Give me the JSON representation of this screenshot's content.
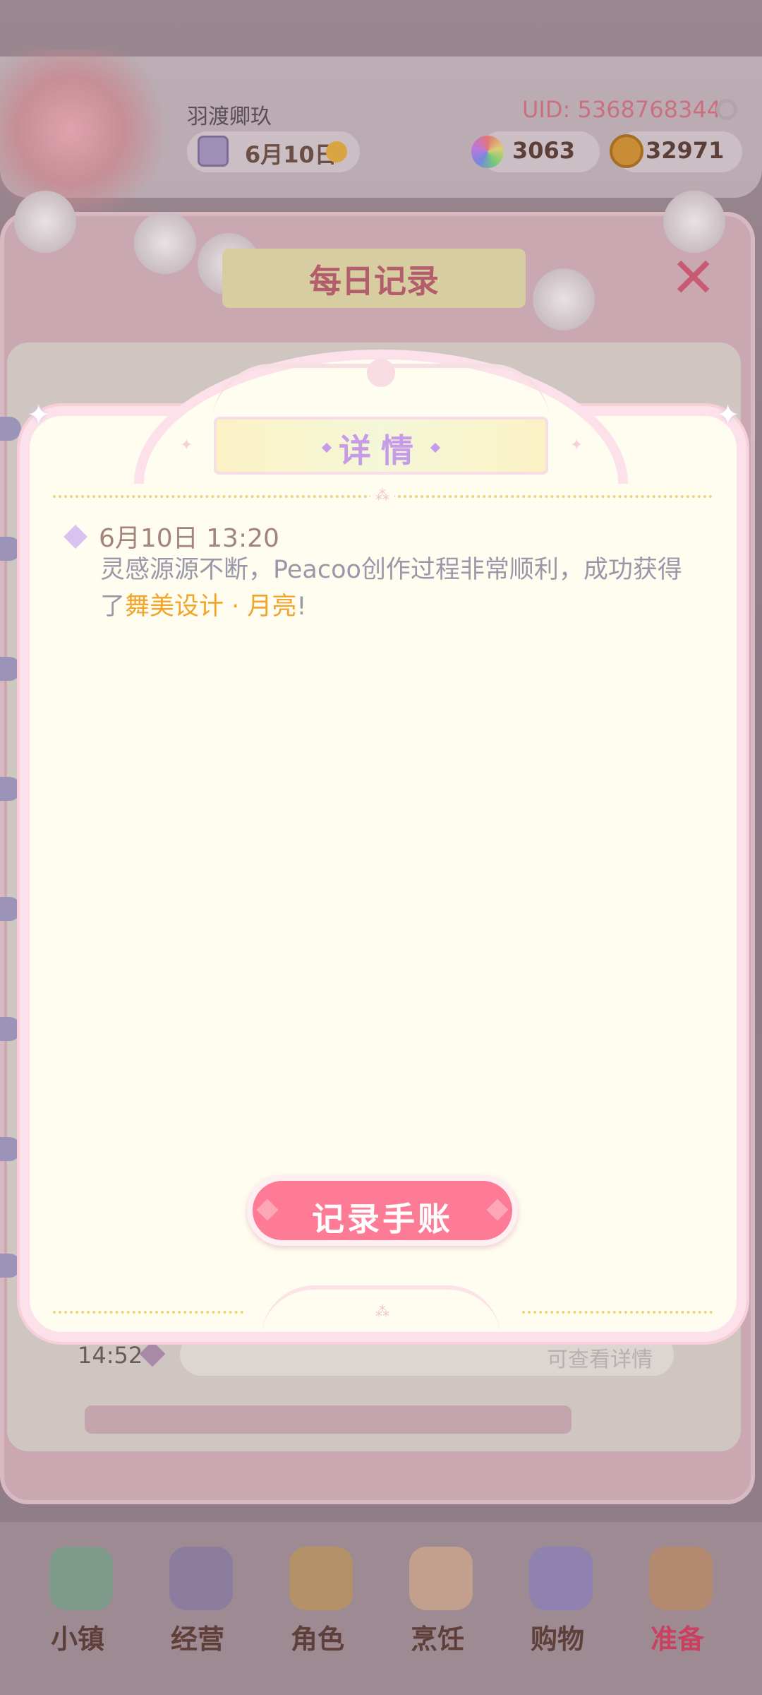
{
  "header": {
    "player_name": "羽渡卿玖",
    "uid": "UID: 5368768344",
    "date": "6月10日",
    "gems": "3063",
    "coins": "32971"
  },
  "record_panel": {
    "title": "每日记录",
    "close_icon": "✕",
    "row_time": "14:52",
    "row_hint": "可查看详情"
  },
  "modal": {
    "title": "详情",
    "entry": {
      "time": "6月10日 13:20",
      "text_before": "灵感源源不断，Peacoo创作过程非常顺利，成功获得了",
      "highlight": "舞美设计 · 月亮",
      "text_after": "!"
    },
    "button_label": "记录手账",
    "bow_icon": "⁂"
  },
  "bottom_nav": {
    "items": [
      {
        "label": "小镇",
        "icon": "map-icon"
      },
      {
        "label": "经营",
        "icon": "bag-icon"
      },
      {
        "label": "角色",
        "icon": "character-icon"
      },
      {
        "label": "烹饪",
        "icon": "cake-icon"
      },
      {
        "label": "购物",
        "icon": "shopping-bag-icon"
      },
      {
        "label": "准备",
        "icon": "basket-icon"
      }
    ]
  },
  "colors": {
    "accent_pink": "#fd7b94",
    "title_purple": "#c69ce8",
    "highlight_orange": "#f2a52a",
    "modal_bg": "#fefdf0"
  }
}
